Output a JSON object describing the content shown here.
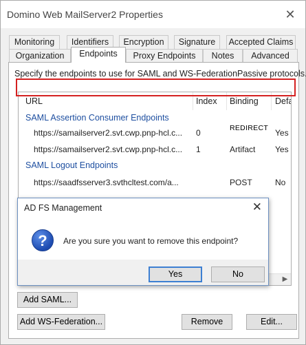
{
  "window": {
    "title": "Domino Web MailServer2 Properties",
    "close_glyph": "✕"
  },
  "tabs_row1": [
    "Monitoring",
    "Identifiers",
    "Encryption",
    "Signature",
    "Accepted Claims"
  ],
  "tabs_row2": [
    "Organization",
    "Endpoints",
    "Proxy Endpoints",
    "Notes",
    "Advanced"
  ],
  "active_tab": "Endpoints",
  "panel": {
    "description": "Specify the endpoints to use for SAML and WS-FederationPassive protocols."
  },
  "list": {
    "columns": [
      "URL",
      "Index",
      "Binding",
      "Defa"
    ],
    "groups": [
      {
        "label": "SAML Assertion Consumer Endpoints",
        "rows": [
          {
            "url": "https://samailserver2.svt.cwp.pnp-hcl.c...",
            "index": "0",
            "binding": "",
            "default": "Yes"
          },
          {
            "url": "https://samailserver2.svt.cwp.pnp-hcl.c...",
            "index": "1",
            "binding": "Artifact",
            "default": "Yes"
          }
        ]
      },
      {
        "label": "SAML Logout Endpoints",
        "rows": [
          {
            "url": "https://saadfsserver3.svthcltest.com/a...",
            "index": "",
            "binding": "POST",
            "default": "No"
          }
        ]
      }
    ],
    "annotation": "REDIRECT",
    "highlight_color": "#d42020"
  },
  "buttons": {
    "add_saml": "Add SAML...",
    "add_wsfed": "Add WS-Federation...",
    "remove": "Remove",
    "edit": "Edit..."
  },
  "dialog": {
    "title": "AD FS Management",
    "icon": "question-icon",
    "message": "Are you sure you want to remove this endpoint?",
    "yes": "Yes",
    "no": "No"
  },
  "colors": {
    "group_label": "#1e4fa0",
    "accent_border": "#3c7fd2"
  }
}
